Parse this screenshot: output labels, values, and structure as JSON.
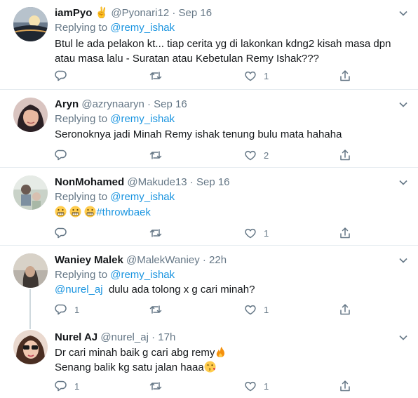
{
  "reply_prefix": "Replying to",
  "tweets": [
    {
      "name": "iamPyo",
      "name_emoji": "✌",
      "handle": "@Pyonari12",
      "separator": "·",
      "time": "Sep 16",
      "reply_to": "@remy_ishak",
      "text": "Btul le ada pelakon kt... tiap cerita yg di lakonkan kdng2 kisah masa dpn atau masa lalu - Suratan atau Kebetulan Remy Ishak???",
      "replies": "",
      "retweets": "",
      "likes": "1"
    },
    {
      "name": "Aryn",
      "handle": "@azrynaaryn",
      "separator": "·",
      "time": "Sep 16",
      "reply_to": "@remy_ishak",
      "text": "Seronoknya jadi Minah Remy ishak tenung bulu mata hahaha",
      "replies": "",
      "retweets": "",
      "likes": "2"
    },
    {
      "name": "NonMohamed",
      "handle": "@Makude13",
      "separator": "·",
      "time": "Sep 16",
      "reply_to": "@remy_ishak",
      "text_hashtag": "#throwbaek",
      "emoji_count": 3,
      "replies": "",
      "retweets": "",
      "likes": "1"
    },
    {
      "name": "Waniey Malek",
      "handle": "@MalekWaniey",
      "separator": "·",
      "time": "22h",
      "reply_to": "@remy_ishak",
      "mention": "@nurel_aj",
      "text": "dulu ada tolong x g cari minah?",
      "replies": "1",
      "retweets": "",
      "likes": "1"
    },
    {
      "name": "Nurel AJ",
      "handle": "@nurel_aj",
      "separator": "·",
      "time": "17h",
      "line1": "Dr cari minah baik g cari abg remy",
      "line2": "Senang balik kg satu jalan haaa",
      "replies": "1",
      "retweets": "",
      "likes": "1"
    }
  ],
  "colors": {
    "text": "#14171a",
    "muted": "#657786",
    "link": "#1b95e0",
    "divider": "#e6ecf0"
  },
  "icons": [
    "chevron-down-icon",
    "reply-icon",
    "retweet-icon",
    "like-icon",
    "share-icon",
    "victory-hand-emoji",
    "grimacing-emoji",
    "fire-emoji",
    "kissing-heart-emoji"
  ]
}
